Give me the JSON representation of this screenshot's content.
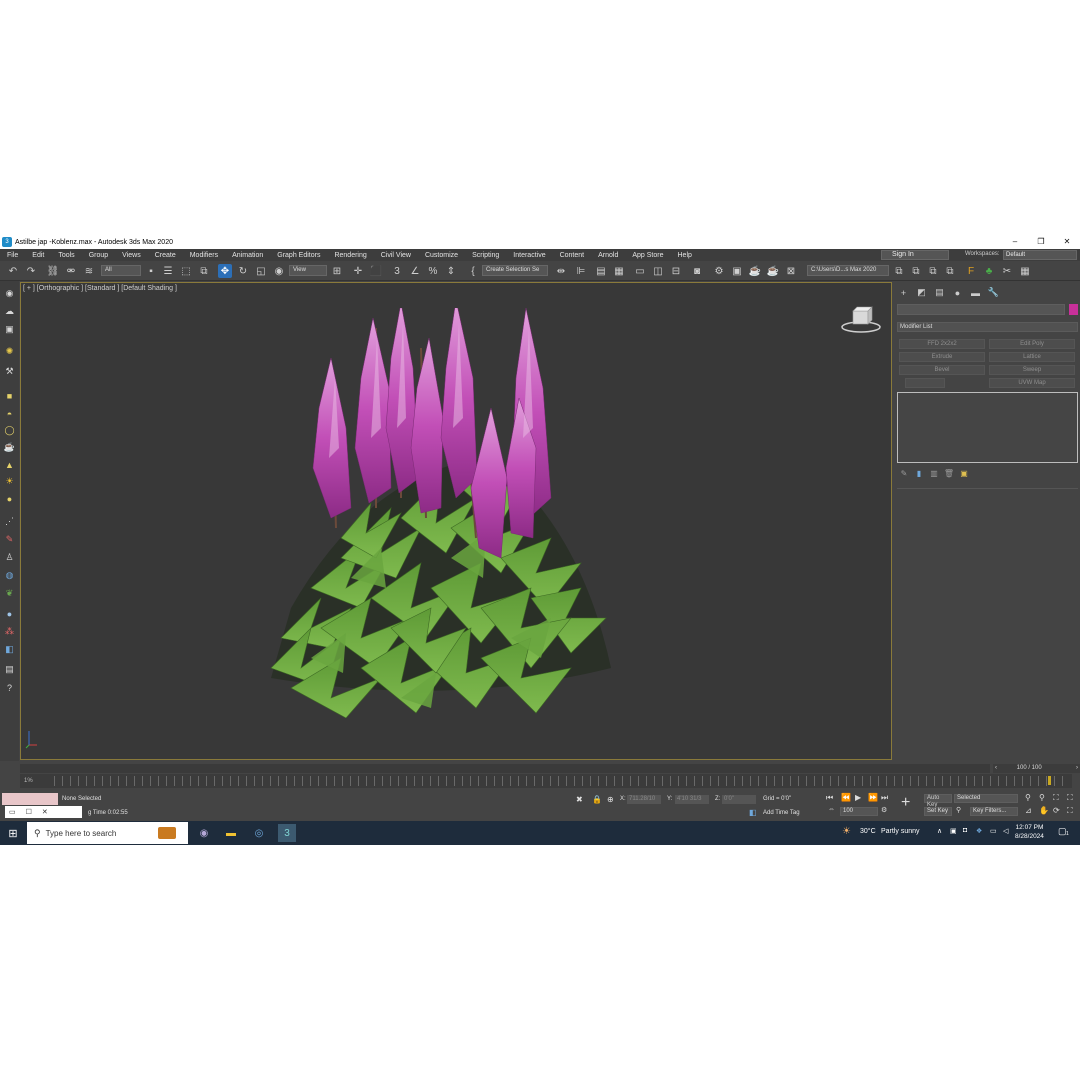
{
  "window": {
    "title": "Astilbe jap -Koblenz.max - Autodesk 3ds Max 2020",
    "controls": [
      "–",
      "❐",
      "✕"
    ]
  },
  "menu": [
    "File",
    "Edit",
    "Tools",
    "Group",
    "Views",
    "Create",
    "Modifiers",
    "Animation",
    "Graph Editors",
    "Rendering",
    "Civil View",
    "Customize",
    "Scripting",
    "Interactive",
    "Content",
    "Arnold",
    "App Store",
    "Help"
  ],
  "account": {
    "signin": "Sign In",
    "workspaces_label": "Workspaces:",
    "workspace": "Default"
  },
  "toolbar": {
    "filter": "All",
    "refcoord": "View",
    "selection_set": "Create Selection Se",
    "project_path": "C:\\Users\\D...s Max 2020"
  },
  "viewport": {
    "label": "[ + ] [Orthographic ] [Standard ] [Default Shading ]"
  },
  "command_panel": {
    "modifier_list": "Modifier List",
    "modifier_buttons": [
      "FFD 2x2x2",
      "Edit Poly",
      "Extrude",
      "Lattice",
      "Bevel",
      "Sweep",
      "",
      "UVW Map"
    ],
    "accent": "#c8309a"
  },
  "timeline": {
    "frame_display": "100 / 100",
    "frame_start": "1%"
  },
  "status": {
    "selection": "None Selected",
    "render_time": "g Time  0:02:55",
    "x_label": "X:",
    "x_value": "711.28/10",
    "y_label": "Y:",
    "y_value": "4'10 31/3",
    "z_label": "Z:",
    "z_value": "0'0\"",
    "grid": "Grid = 0'0\"",
    "add_time_tag": "Add Time Tag",
    "auto_key": "Auto Key",
    "key_mode": "Selected",
    "set_key": "Set Key",
    "key_filters": "Key Filters...",
    "frame_field": "100"
  },
  "taskbar": {
    "search_placeholder": "Type here to search",
    "weather_temp": "30°C",
    "weather_desc": "Partly sunny",
    "time": "12:07 PM",
    "date": "8/28/2024",
    "notification_count": "1"
  },
  "scene": {
    "flower_color": "#c24fb7",
    "leaf_color": "#5f9a3a",
    "background": "#383838"
  }
}
